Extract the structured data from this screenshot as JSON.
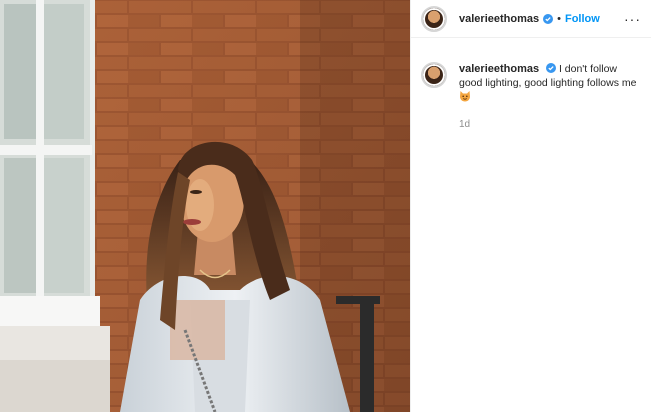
{
  "post": {
    "username": "valerieethomas",
    "follow_label": "Follow",
    "separator": "•",
    "more_label": "···",
    "caption": "I don't follow good lighting, good lighting follows me",
    "timestamp": "1d",
    "icons": {
      "verified": "verified-badge-icon",
      "more": "more-options-icon",
      "caption_emoji": "smiling-cat-emoji-icon"
    },
    "colors": {
      "link_blue": "#0095f6",
      "verified_blue": "#3897f0",
      "secondary_text": "#8e8e8e"
    }
  }
}
